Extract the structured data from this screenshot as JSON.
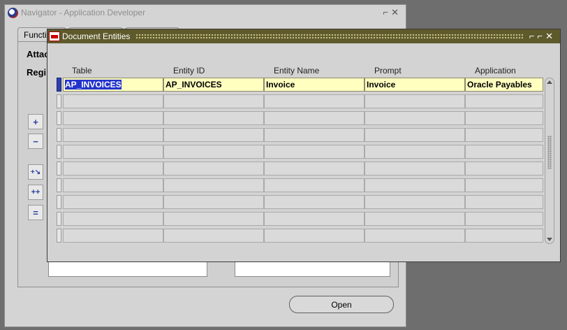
{
  "navigator": {
    "title": "Navigator - Application Developer",
    "tabs": [
      "Functions",
      "",
      ""
    ],
    "labels": [
      "Attac",
      "Regi"
    ],
    "buttons": {
      "add": "+",
      "remove": "−",
      "expand": "+↘",
      "expand_all": "++",
      "collapse_all": "=",
      "open": "Open"
    }
  },
  "window_controls": {
    "minimize": "⸺",
    "restore": "⌐",
    "close": "✕"
  },
  "document_entities": {
    "title": "Document Entities",
    "columns": [
      "Table",
      "Entity ID",
      "Entity Name",
      "Prompt",
      "Application"
    ],
    "rows": [
      [
        "AP_INVOICES",
        "AP_INVOICES",
        "Invoice",
        "Invoice",
        "Oracle Payables"
      ],
      [
        "",
        "",
        "",
        "",
        ""
      ],
      [
        "",
        "",
        "",
        "",
        ""
      ],
      [
        "",
        "",
        "",
        "",
        ""
      ],
      [
        "",
        "",
        "",
        "",
        ""
      ],
      [
        "",
        "",
        "",
        "",
        ""
      ],
      [
        "",
        "",
        "",
        "",
        ""
      ],
      [
        "",
        "",
        "",
        "",
        ""
      ],
      [
        "",
        "",
        "",
        "",
        ""
      ],
      [
        "",
        "",
        "",
        "",
        ""
      ]
    ]
  }
}
